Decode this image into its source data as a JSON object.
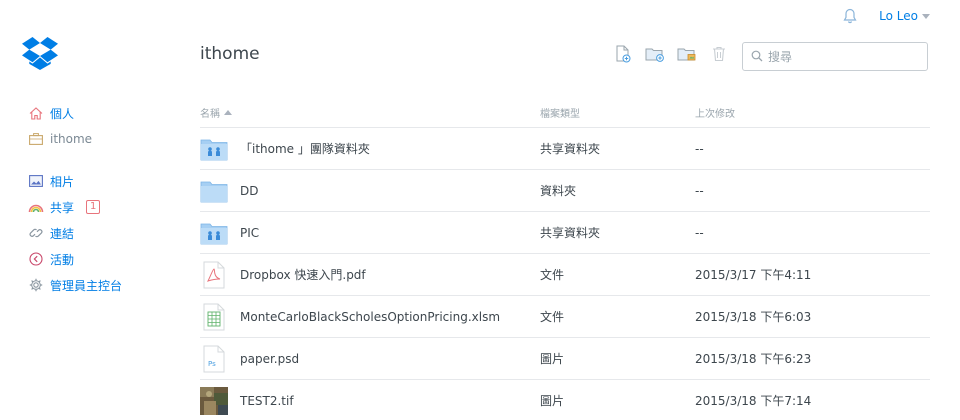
{
  "header": {
    "user_name": "Lo Leo",
    "page_title": "ithome",
    "search_placeholder": "搜尋"
  },
  "sidebar": {
    "groups": [
      [
        {
          "label": "個人",
          "icon": "home-icon"
        },
        {
          "label": "ithome",
          "icon": "briefcase-icon"
        }
      ],
      [
        {
          "label": "相片",
          "icon": "photos-icon"
        },
        {
          "label": "共享",
          "icon": "rainbow-icon",
          "badge": "1"
        },
        {
          "label": "連結",
          "icon": "link-icon"
        },
        {
          "label": "活動",
          "icon": "activity-icon"
        },
        {
          "label": "管理員主控台",
          "icon": "gear-icon"
        }
      ]
    ]
  },
  "table": {
    "columns": [
      "名稱",
      "檔案類型",
      "上次修改"
    ],
    "rows": [
      {
        "name": "「ithome 」團隊資料夾",
        "type": "共享資料夾",
        "modified": "--",
        "icon": "shared-folder-icon"
      },
      {
        "name": "DD",
        "type": "資料夾",
        "modified": "--",
        "icon": "folder-icon"
      },
      {
        "name": "PIC",
        "type": "共享資料夾",
        "modified": "--",
        "icon": "shared-folder-icon"
      },
      {
        "name": "Dropbox 快速入門.pdf",
        "type": "文件",
        "modified": "2015/3/17 下午4:11",
        "icon": "pdf-icon"
      },
      {
        "name": "MonteCarloBlackScholesOptionPricing.xlsm",
        "type": "文件",
        "modified": "2015/3/18 下午6:03",
        "icon": "spreadsheet-icon"
      },
      {
        "name": "paper.psd",
        "type": "圖片",
        "modified": "2015/3/18 下午6:23",
        "icon": "psd-icon"
      },
      {
        "name": "TEST2.tif",
        "type": "圖片",
        "modified": "2015/3/18 下午7:14",
        "icon": "image-thumbnail-icon"
      }
    ]
  },
  "colors": {
    "accent": "#007ee5",
    "folder": "#a6cff3",
    "badge": "#e8747c"
  }
}
